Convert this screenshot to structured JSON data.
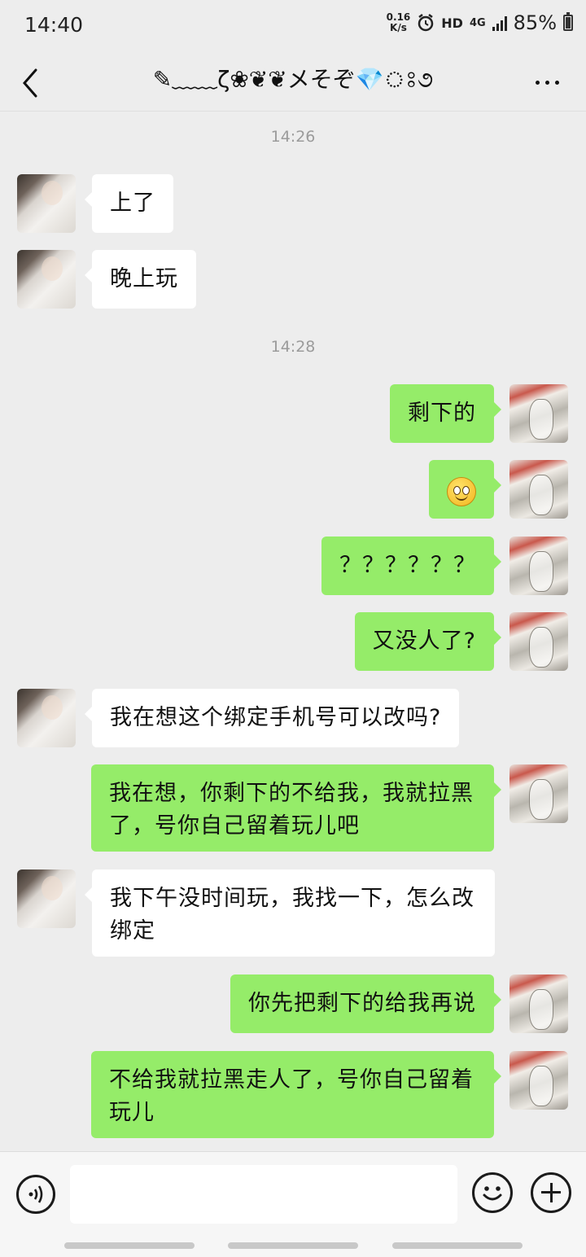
{
  "status_bar": {
    "time": "14:40",
    "net_speed_value": "0.16",
    "net_speed_unit": "K/s",
    "alarm_icon": "alarm-clock-icon",
    "hd_label": "HD",
    "network_label": "4G",
    "battery_percent": "85%",
    "battery_level": 0.85
  },
  "nav": {
    "back_icon": "chevron-left-icon",
    "title": "✎﹏﹏ζ❀❦❦メそぞ💎ঃ૭",
    "more_icon": "more-dots-icon"
  },
  "conversation": {
    "timestamps": [
      "14:26",
      "14:28"
    ],
    "messages": [
      {
        "side": "in",
        "text": "上了"
      },
      {
        "side": "in",
        "text": "晚上玩"
      },
      {
        "side": "out",
        "text": "剩下的"
      },
      {
        "side": "out",
        "text": "",
        "emoji": "smile-emoji-icon"
      },
      {
        "side": "out",
        "text": "？？？？？？"
      },
      {
        "side": "out",
        "text": "又没人了?"
      },
      {
        "side": "in",
        "text": "我在想这个绑定手机号可以改吗?"
      },
      {
        "side": "out",
        "text": "我在想，你剩下的不给我，我就拉黑了，号你自己留着玩儿吧"
      },
      {
        "side": "in",
        "text": "我下午没时间玩，我找一下，怎么改绑定"
      },
      {
        "side": "out",
        "text": "你先把剩下的给我再说"
      },
      {
        "side": "out",
        "text": "不给我就拉黑走人了，号你自己留着玩儿"
      }
    ]
  },
  "input_bar": {
    "voice_icon": "voice-input-icon",
    "text_value": "",
    "emoji_icon": "emoji-face-icon",
    "plus_icon": "plus-circle-icon"
  },
  "colors": {
    "background": "#ededed",
    "outgoing_bubble": "#95ec69",
    "incoming_bubble": "#ffffff",
    "timestamp_text": "#9b9b9b"
  }
}
